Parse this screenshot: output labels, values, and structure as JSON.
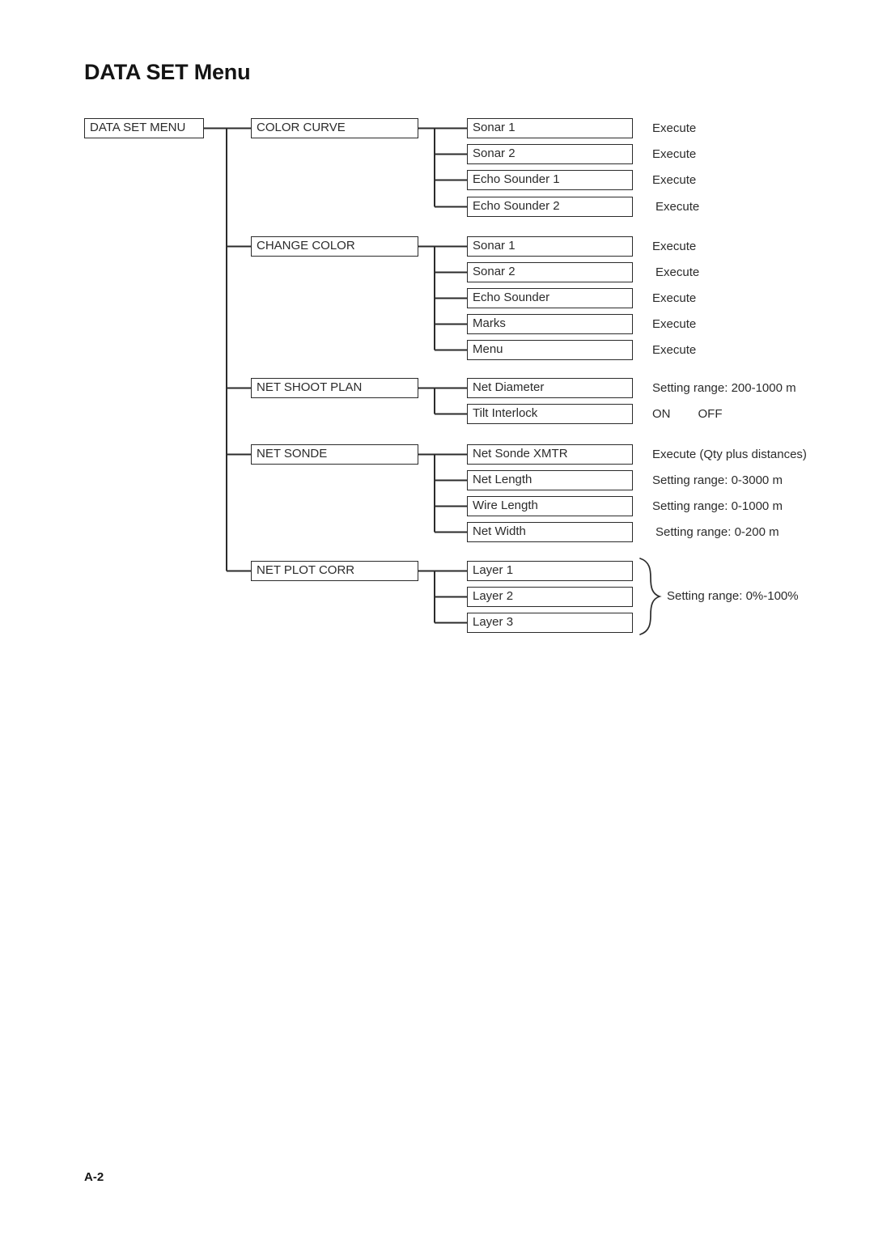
{
  "page": {
    "title": "DATA SET Menu",
    "footer": "A-2"
  },
  "diagram": {
    "root": {
      "label": "DATA SET MENU"
    },
    "groups": [
      {
        "label": "COLOR CURVE",
        "items": [
          {
            "label": "Sonar 1",
            "note": "Execute"
          },
          {
            "label": "Sonar 2",
            "note": "Execute"
          },
          {
            "label": "Echo Sounder 1",
            "note": "Execute"
          },
          {
            "label": "Echo Sounder 2",
            "note": "Execute"
          }
        ]
      },
      {
        "label": "CHANGE COLOR",
        "items": [
          {
            "label": "Sonar 1",
            "note": "Execute"
          },
          {
            "label": "Sonar 2",
            "note": "Execute"
          },
          {
            "label": "Echo Sounder",
            "note": "Execute"
          },
          {
            "label": "Marks",
            "note": "Execute"
          },
          {
            "label": "Menu",
            "note": "Execute"
          }
        ]
      },
      {
        "label": "NET SHOOT PLAN",
        "items": [
          {
            "label": "Net Diameter",
            "note": "Setting range: 200-1000 m"
          },
          {
            "label": "Tilt Interlock",
            "note_on": "ON",
            "note_off": "OFF"
          }
        ]
      },
      {
        "label": "NET SONDE",
        "items": [
          {
            "label": "Net Sonde XMTR",
            "note": "Execute (Qty plus distances)"
          },
          {
            "label": "Net Length",
            "note": "Setting range: 0-3000 m"
          },
          {
            "label": "Wire Length",
            "note": "Setting range: 0-1000 m"
          },
          {
            "label": "Net Width",
            "note": "Setting range: 0-200 m"
          }
        ]
      },
      {
        "label": "NET PLOT CORR",
        "items": [
          {
            "label": "Layer 1"
          },
          {
            "label": "Layer 2"
          },
          {
            "label": "Layer 3"
          }
        ],
        "brace_note": "Setting range: 0%-100%"
      }
    ]
  },
  "colors": {
    "line": "#2b2b2b",
    "text": "#2b2b2b",
    "background": "#ffffff"
  }
}
